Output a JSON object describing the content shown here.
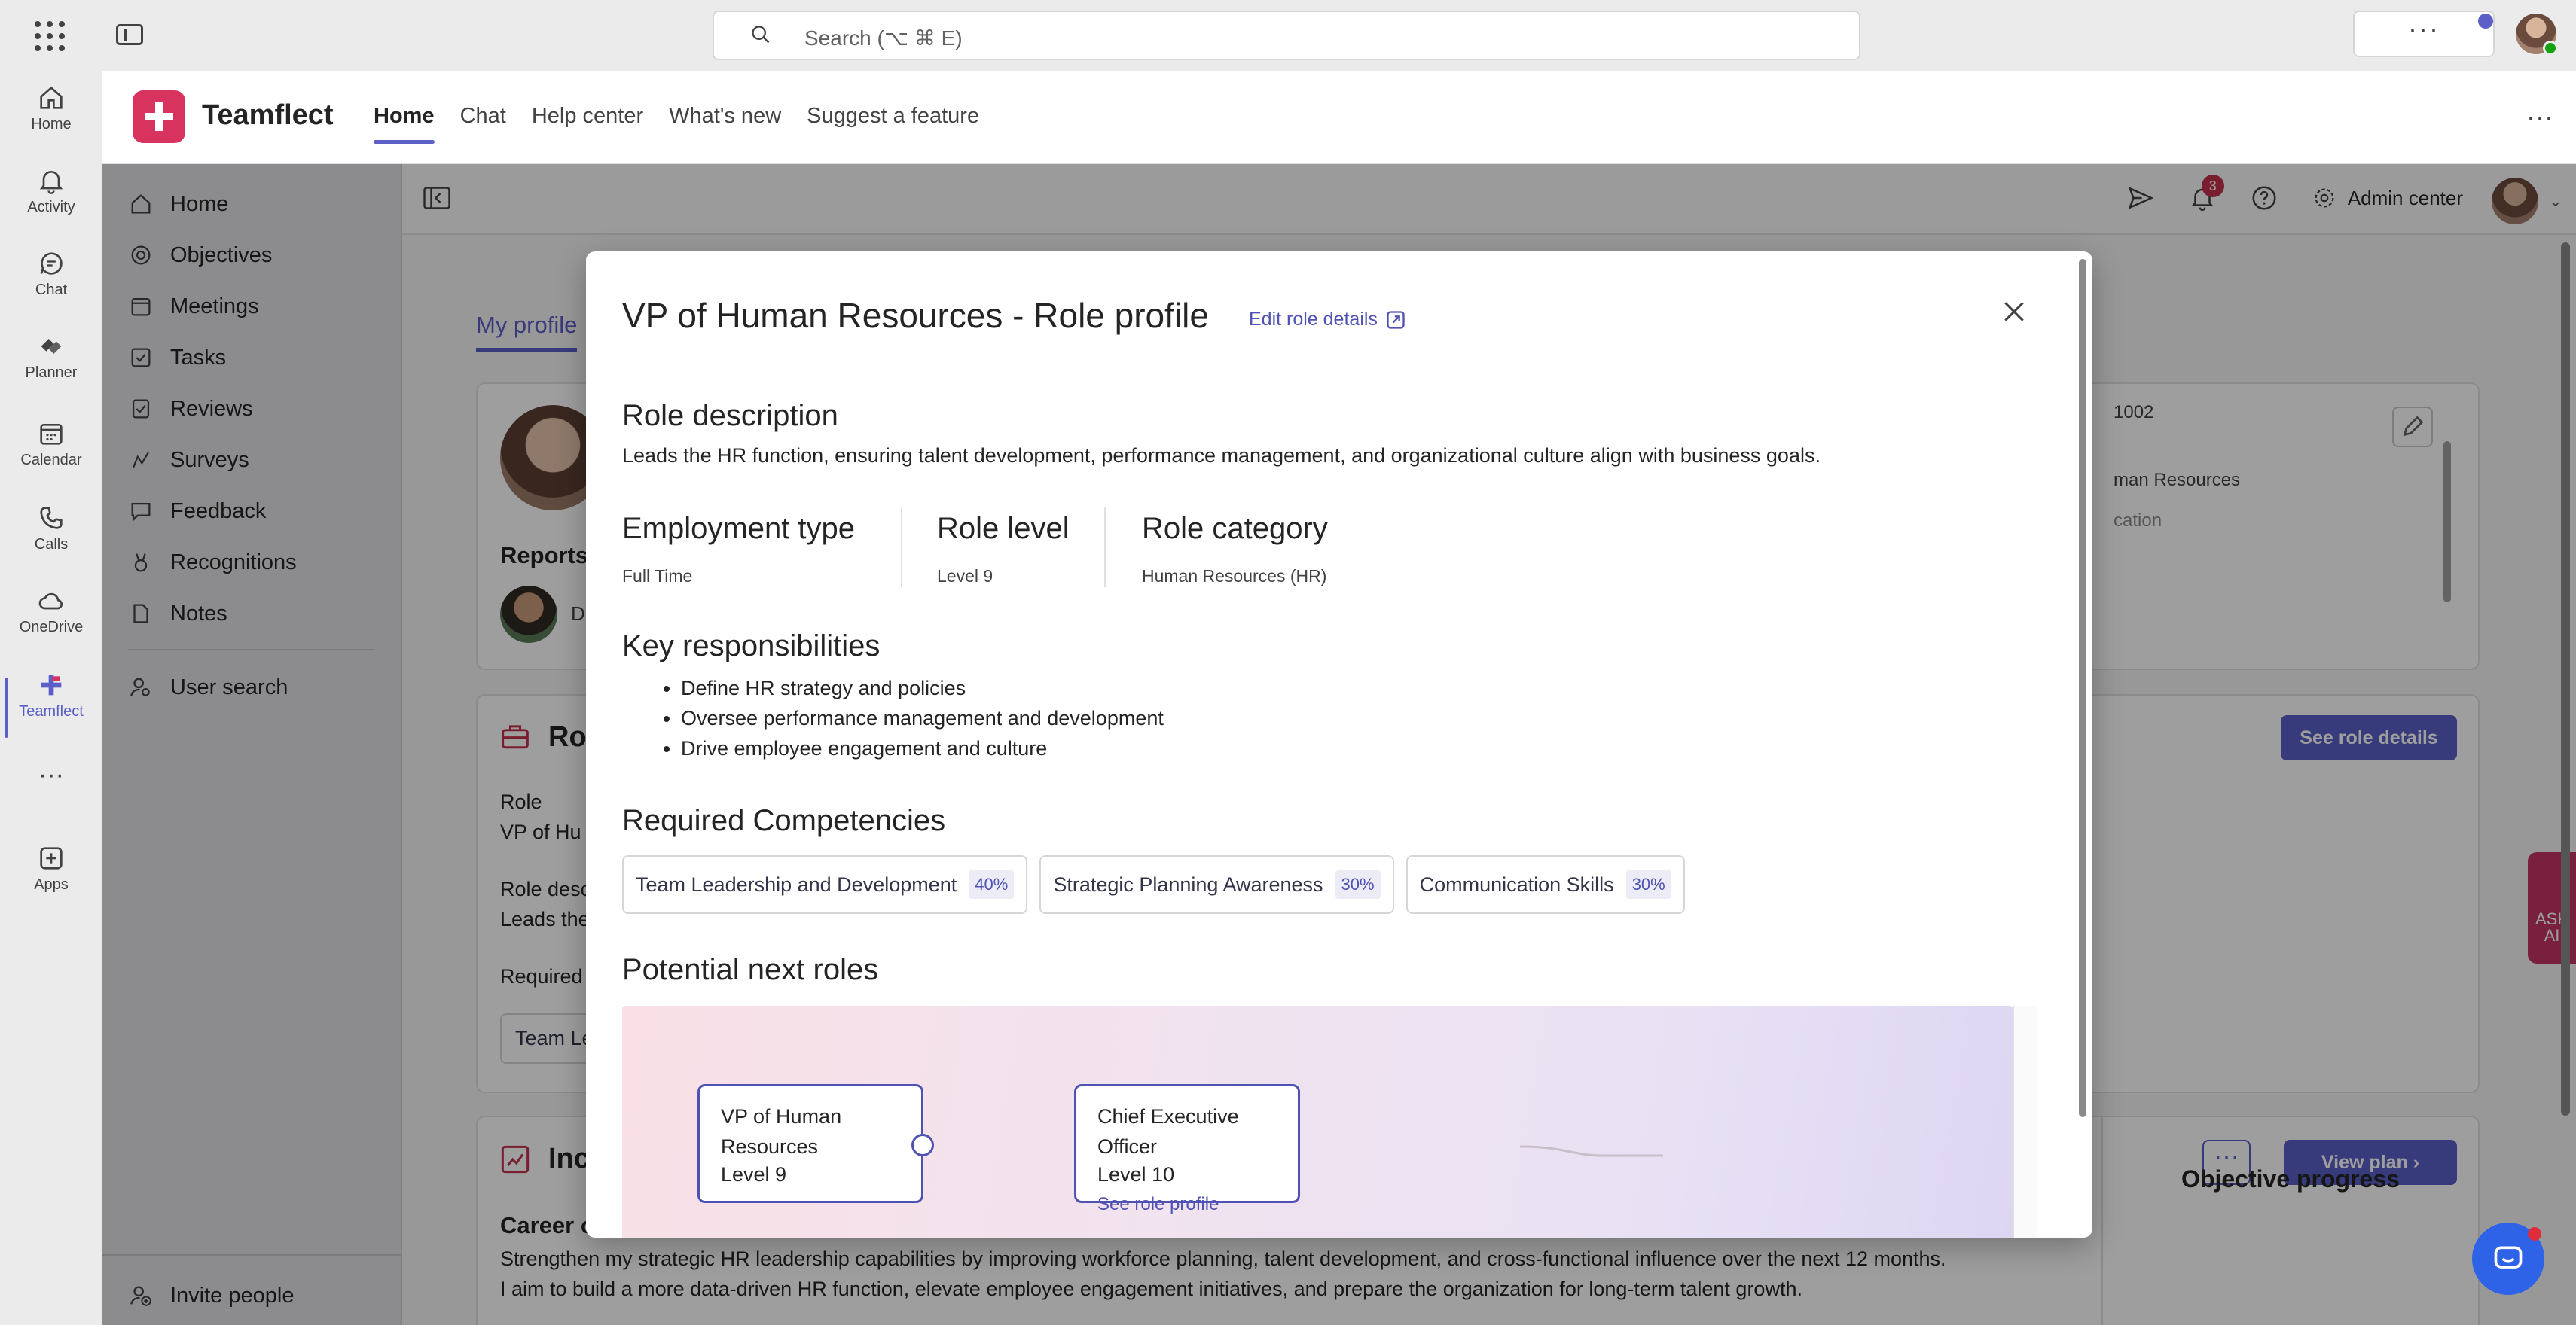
{
  "topbar": {
    "search_placeholder": "Search (⌥ ⌘ E)",
    "more_label": "···"
  },
  "rail": [
    {
      "label": "Home",
      "icon": "home-icon"
    },
    {
      "label": "Activity",
      "icon": "bell-icon"
    },
    {
      "label": "Chat",
      "icon": "chat-icon"
    },
    {
      "label": "Planner",
      "icon": "planner-icon"
    },
    {
      "label": "Calendar",
      "icon": "calendar-icon"
    },
    {
      "label": "Calls",
      "icon": "phone-icon"
    },
    {
      "label": "OneDrive",
      "icon": "cloud-icon"
    },
    {
      "label": "Teamflect",
      "icon": "teamflect-icon"
    },
    {
      "label": "···",
      "icon": "more-icon"
    },
    {
      "label": "Apps",
      "icon": "apps-icon"
    }
  ],
  "app": {
    "name": "Teamflect",
    "tabs": [
      "Home",
      "Chat",
      "Help center",
      "What's new",
      "Suggest a feature"
    ],
    "active_tab": "Home",
    "more": "···"
  },
  "leftnav": {
    "items": [
      "Home",
      "Objectives",
      "Meetings",
      "Tasks",
      "Reviews",
      "Surveys",
      "Feedback",
      "Recognitions",
      "Notes"
    ],
    "user_search": "User search",
    "invite": "Invite people"
  },
  "toolbar": {
    "admin_center": "Admin center",
    "notification_count": "3"
  },
  "background": {
    "my_profile_tab": "My profile",
    "reports": "Reports",
    "report_initial": "D",
    "employee_id": "1002",
    "department": "man Resources",
    "location": "cation",
    "role_card_title": "Ro",
    "role_label": "Role",
    "role_value": "VP of Hu",
    "role_desc_label": "Role desc",
    "role_desc_value": "Leads the",
    "required_label": "Required",
    "required_chip": "Team Le",
    "see_role_details": "See role details",
    "ind_title": "Inc",
    "view_plan": "View plan",
    "ind_more": "···",
    "career_title": "Career objective",
    "career_text_1": "Strengthen my strategic HR leadership capabilities by improving workforce planning, talent development, and cross-functional influence over the next 12 months.",
    "career_text_2": "I aim to build a more data-driven HR function, elevate employee engagement initiatives, and prepare the organization for long-term talent growth.",
    "objective_progress": "Objective progress",
    "ask_ai": "ASK AI"
  },
  "modal": {
    "title": "VP of Human Resources - Role profile",
    "edit_link": "Edit role details",
    "role_description_heading": "Role description",
    "role_description": "Leads the HR function, ensuring talent development, performance management, and organizational culture align with business goals.",
    "employment_type_heading": "Employment type",
    "employment_type": "Full Time",
    "role_level_heading": "Role level",
    "role_level": "Level 9",
    "role_category_heading": "Role category",
    "role_category": "Human Resources (HR)",
    "responsibilities_heading": "Key responsibilities",
    "responsibilities": [
      "Define HR strategy and policies",
      "Oversee performance management and development",
      "Drive employee engagement and culture"
    ],
    "competencies_heading": "Required Competencies",
    "competencies": [
      {
        "name": "Team Leadership and Development",
        "pct": "40%"
      },
      {
        "name": "Strategic Planning Awareness",
        "pct": "30%"
      },
      {
        "name": "Communication Skills",
        "pct": "30%"
      }
    ],
    "next_roles_heading": "Potential next roles",
    "current_node": {
      "title_1": "VP of Human",
      "title_2": "Resources",
      "level": "Level 9"
    },
    "next_node": {
      "title_1": "Chief Executive",
      "title_2": "Officer",
      "level": "Level 10",
      "link": "See role profile"
    }
  },
  "colors": {
    "accent": "#5b5fc7",
    "link": "#4f52b2",
    "brand": "#d8335f"
  }
}
